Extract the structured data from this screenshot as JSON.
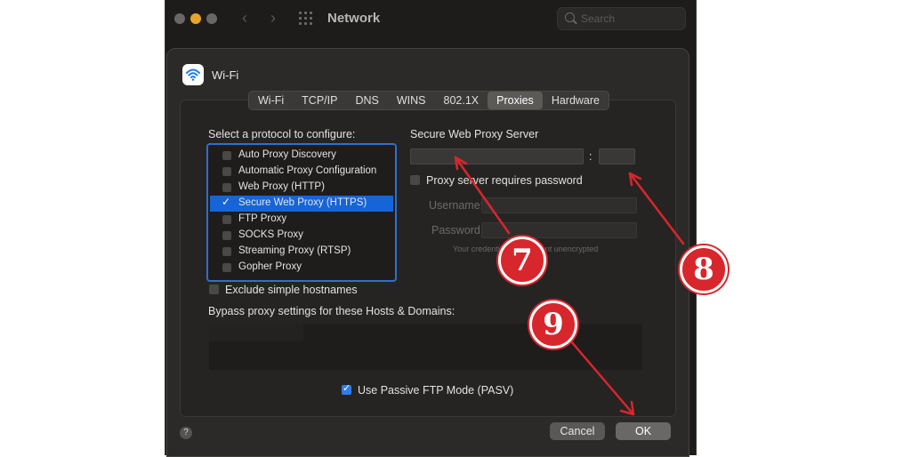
{
  "window": {
    "title": "Network",
    "search_placeholder": "Search"
  },
  "sheet": {
    "title": "Wi-Fi"
  },
  "tabs": [
    "Wi-Fi",
    "TCP/IP",
    "DNS",
    "WINS",
    "802.1X",
    "Proxies",
    "Hardware"
  ],
  "active_tab": "Proxies",
  "protocols": {
    "label": "Select a protocol to configure:",
    "items": [
      {
        "label": "Auto Proxy Discovery",
        "checked": false
      },
      {
        "label": "Automatic Proxy Configuration",
        "checked": false
      },
      {
        "label": "Web Proxy (HTTP)",
        "checked": false
      },
      {
        "label": "Secure Web Proxy (HTTPS)",
        "checked": true,
        "selected": true
      },
      {
        "label": "FTP Proxy",
        "checked": false
      },
      {
        "label": "SOCKS Proxy",
        "checked": false
      },
      {
        "label": "Streaming Proxy (RTSP)",
        "checked": false
      },
      {
        "label": "Gopher Proxy",
        "checked": false
      }
    ]
  },
  "server": {
    "title": "Secure Web Proxy Server",
    "colon": ":",
    "host_value": "",
    "port_value": "",
    "requires_password_label": "Proxy server requires password",
    "username_label": "Username:",
    "password_label": "Password:",
    "note": "Your credentials will be sent unencrypted"
  },
  "exclude_simple_hostnames": {
    "label": "Exclude simple hostnames",
    "checked": false
  },
  "bypass": {
    "label": "Bypass proxy settings for these Hosts & Domains:",
    "value": ""
  },
  "passive_ftp": {
    "label": "Use Passive FTP Mode (PASV)",
    "checked": true
  },
  "buttons": {
    "help": "?",
    "cancel": "Cancel",
    "ok": "OK"
  },
  "annotations": {
    "badge_7": "7",
    "badge_8": "8",
    "badge_9": "9",
    "color": "#d8262d"
  },
  "colors": {
    "accent": "#2f7de8",
    "selection": "#1565d8"
  }
}
